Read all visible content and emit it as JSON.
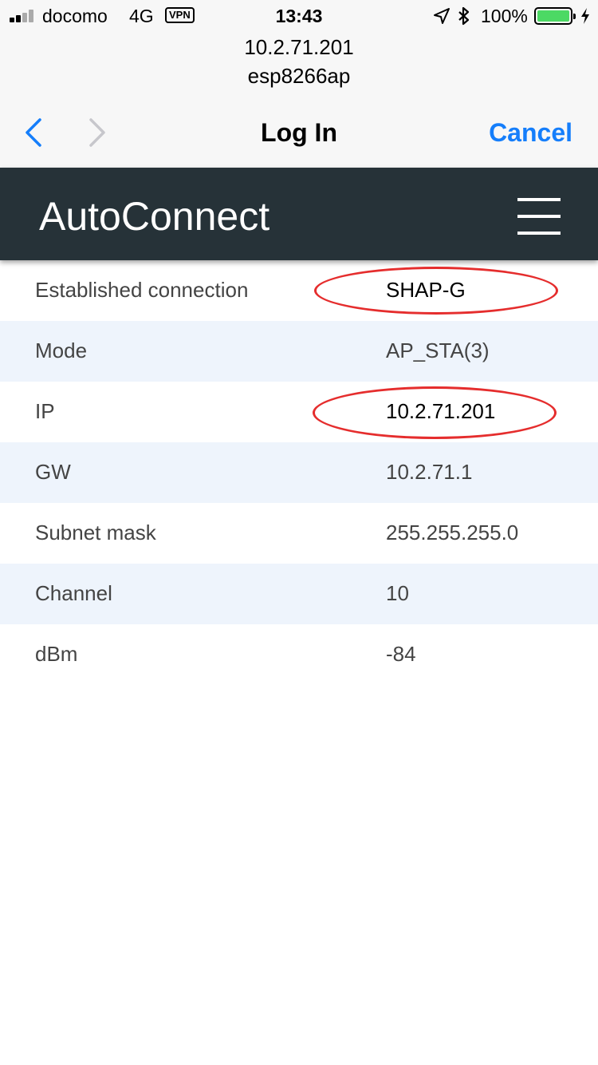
{
  "status_bar": {
    "carrier": "docomo",
    "network": "4G",
    "vpn": "VPN",
    "time": "13:43",
    "battery_percent": "100%",
    "icons": [
      "signal-icon",
      "location-icon",
      "bluetooth-icon",
      "battery-icon",
      "charging-icon"
    ],
    "battery_level": 1.0,
    "battery_color": "#4cd964"
  },
  "browser": {
    "address": "10.2.71.201",
    "ssid": "esp8266ap"
  },
  "navigation": {
    "title": "Log In",
    "cancel_label": "Cancel",
    "accent_color": "#157efb",
    "icons": [
      "chevron-left-icon",
      "chevron-right-icon"
    ]
  },
  "app": {
    "brand": "AutoConnect",
    "header_color": "#263238",
    "menu_icon": "hamburger-menu-icon"
  },
  "connection": {
    "rows": [
      {
        "label": "Established connection",
        "value": "SHAP-G",
        "highlighted": true
      },
      {
        "label": "Mode",
        "value": "AP_STA(3)",
        "highlighted": false
      },
      {
        "label": "IP",
        "value": "10.2.71.201",
        "highlighted": true
      },
      {
        "label": "GW",
        "value": "10.2.71.1",
        "highlighted": false
      },
      {
        "label": "Subnet mask",
        "value": "255.255.255.0",
        "highlighted": false
      },
      {
        "label": "Channel",
        "value": "10",
        "highlighted": false
      },
      {
        "label": "dBm",
        "value": "-84",
        "highlighted": false
      }
    ],
    "alt_row_color": "#eef4fc",
    "highlight_color": "#e52d2d"
  }
}
